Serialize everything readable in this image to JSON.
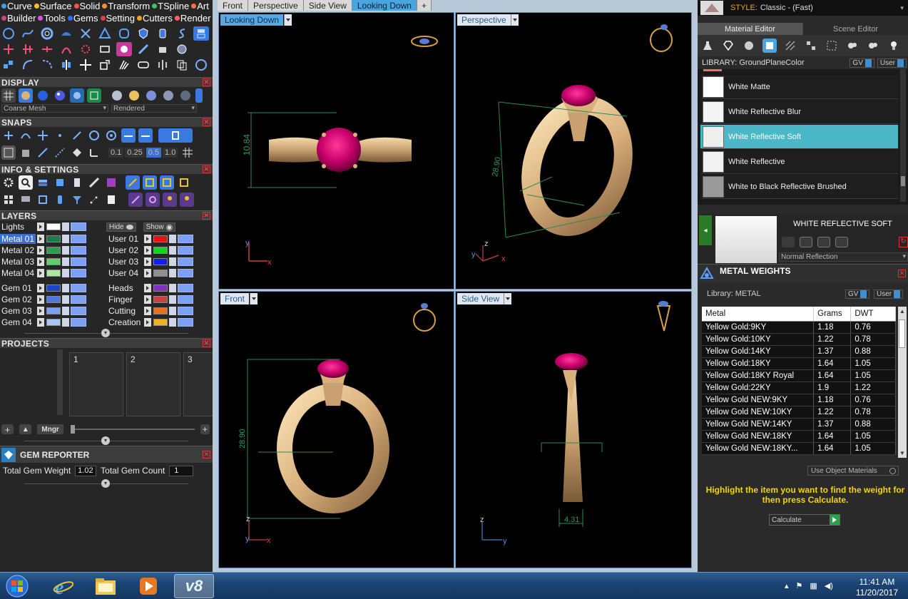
{
  "menu": {
    "row1": [
      {
        "label": "Curve",
        "color": "#39a0f0"
      },
      {
        "label": "Surface",
        "color": "#f0c030"
      },
      {
        "label": "Solid",
        "color": "#ff5050"
      },
      {
        "label": "Transform",
        "color": "#f09030"
      },
      {
        "label": "TSpline",
        "color": "#40c060"
      },
      {
        "label": "Art",
        "color": "#ff7040"
      }
    ],
    "row2": [
      {
        "label": "Builder",
        "color": "#d04090"
      },
      {
        "label": "Tools",
        "color": "#e050e0"
      },
      {
        "label": "Gems",
        "color": "#3070ff"
      },
      {
        "label": "Setting",
        "color": "#e04040"
      },
      {
        "label": "Cutters",
        "color": "#f0a020"
      },
      {
        "label": "Render",
        "color": "#ff6060"
      }
    ]
  },
  "panels": {
    "display": {
      "title": "DISPLAY",
      "mesh": "Coarse Mesh",
      "mode": "Rendered"
    },
    "snaps": {
      "title": "SNAPS",
      "values": [
        "0.1",
        "0.25",
        "0.5",
        "1.0"
      ]
    },
    "info": {
      "title": "INFO & SETTINGS"
    },
    "layers": {
      "title": "LAYERS",
      "lights": "Lights",
      "hide": "Hide",
      "show": "Show",
      "left": [
        {
          "name": "Metal 01",
          "color": "#1d7a4a",
          "selected": true
        },
        {
          "name": "Metal 02",
          "color": "#28a050"
        },
        {
          "name": "Metal 03",
          "color": "#5cd06a"
        },
        {
          "name": "Metal 04",
          "color": "#a8e8a0"
        },
        {
          "name": "Gem 01",
          "color": "#1848c8"
        },
        {
          "name": "Gem 02",
          "color": "#4a7ae0"
        },
        {
          "name": "Gem 03",
          "color": "#7aa0f0"
        },
        {
          "name": "Gem 04",
          "color": "#a8c4f8"
        }
      ],
      "right": [
        {
          "name": "User 01",
          "color": "#e81010"
        },
        {
          "name": "User 02",
          "color": "#10d820"
        },
        {
          "name": "User 03",
          "color": "#1020e8"
        },
        {
          "name": "User 04",
          "color": "#909090"
        },
        {
          "name": "Heads",
          "color": "#8030c0"
        },
        {
          "name": "Finger",
          "color": "#c84040"
        },
        {
          "name": "Cutting",
          "color": "#e87020"
        },
        {
          "name": "Creation",
          "color": "#f0b020"
        }
      ]
    },
    "projects": {
      "title": "PROJECTS",
      "slots": [
        "1",
        "2",
        "3"
      ],
      "mngr": "Mngr"
    },
    "gem_reporter": {
      "title": "GEM REPORTER",
      "weight_label": "Total Gem Weight",
      "weight_value": "1.02",
      "count_label": "Total Gem Count",
      "count_value": "1"
    }
  },
  "view_tabs": [
    "Front",
    "Perspective",
    "Side View",
    "Looking Down"
  ],
  "active_tab": "Looking Down",
  "viewports": [
    {
      "label": "Looking Down",
      "dimension": "10.84",
      "axes": [
        "y",
        "x"
      ]
    },
    {
      "label": "Perspective",
      "dimension": "28.90",
      "axes": [
        "z",
        "y",
        "x"
      ]
    },
    {
      "label": "Front",
      "dimension": "28.90",
      "axes": [
        "z",
        "y",
        "x"
      ]
    },
    {
      "label": "Side View",
      "dimension": "4.31",
      "axes": [
        "z",
        "y"
      ]
    }
  ],
  "right_panel": {
    "style_label": "STYLE:",
    "style_value": "Classic - (Fast)",
    "tabs": [
      "Material Editor",
      "Scene Editor"
    ],
    "library_label": "LIBRARY: GroundPlaneColor",
    "gv": "GV",
    "user": "User",
    "materials": [
      {
        "name": "White Matte",
        "swatch": "#ffffff"
      },
      {
        "name": "White Reflective Blur",
        "swatch": "#f4f4f4"
      },
      {
        "name": "White Reflective Soft",
        "swatch": "#efefef",
        "selected": true
      },
      {
        "name": "White Reflective",
        "swatch": "#f2f2f2"
      },
      {
        "name": "White to Black Reflective Brushed",
        "swatch": "#9a9a9a"
      }
    ],
    "preview_title": "WHITE REFLECTIVE SOFT",
    "reflection_mode": "Normal Reflection",
    "metal_weights": {
      "title": "METAL WEIGHTS",
      "library": "Library: METAL",
      "columns": [
        "Metal",
        "Grams",
        "DWT"
      ],
      "rows": [
        [
          "Yellow Gold:9KY",
          "1.18",
          "0.76"
        ],
        [
          "Yellow Gold:10KY",
          "1.22",
          "0.78"
        ],
        [
          "Yellow Gold:14KY",
          "1.37",
          "0.88"
        ],
        [
          "Yellow Gold:18KY",
          "1.64",
          "1.05"
        ],
        [
          "Yellow Gold:18KY Royal",
          "1.64",
          "1.05"
        ],
        [
          "Yellow Gold:22KY",
          "1.9",
          "1.22"
        ],
        [
          "Yellow Gold NEW:9KY",
          "1.18",
          "0.76"
        ],
        [
          "Yellow Gold NEW:10KY",
          "1.22",
          "0.78"
        ],
        [
          "Yellow Gold NEW:14KY",
          "1.37",
          "0.88"
        ],
        [
          "Yellow Gold NEW:18KY",
          "1.64",
          "1.05"
        ],
        [
          "Yellow Gold NEW:18KY...",
          "1.64",
          "1.05"
        ]
      ],
      "use_object_materials": "Use Object Materials",
      "hint": "Highlight the item you want to find the weight for then press Calculate.",
      "calculate": "Calculate"
    }
  },
  "taskbar": {
    "time": "11:41 AM",
    "date": "11/20/2017",
    "apps": [
      "windows-start",
      "internet-explorer",
      "file-explorer",
      "media-player",
      "rhino-v8"
    ],
    "active_app_label": "v8"
  },
  "colors": {
    "accent": "#4aa4e0",
    "selection": "#4cb7c6",
    "gold": "#d8b07a",
    "gem": "#e0116f",
    "hint_text": "#f5d400"
  }
}
